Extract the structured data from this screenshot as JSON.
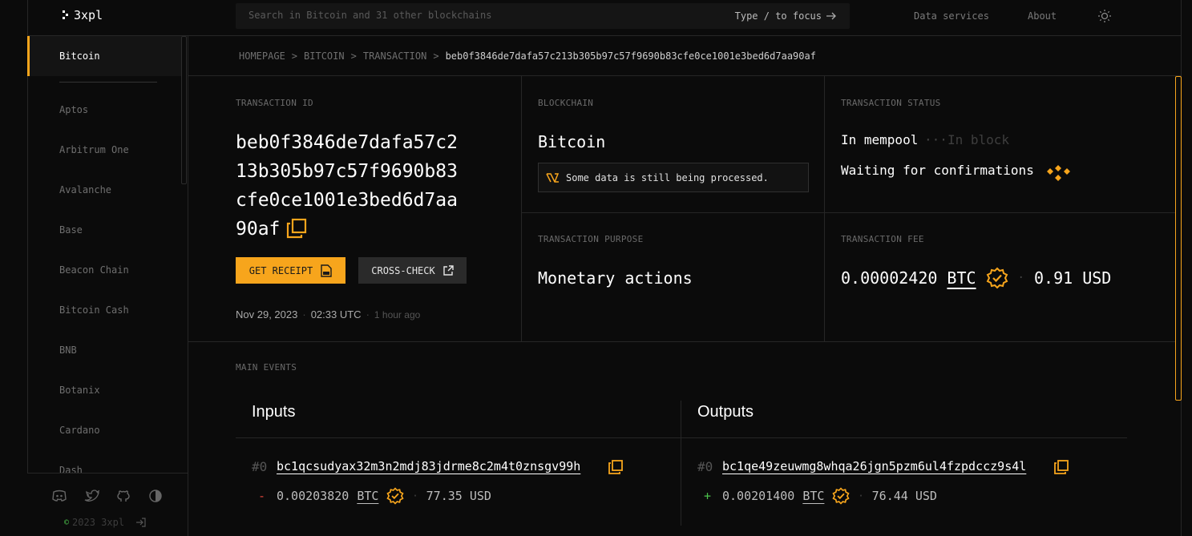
{
  "brand": {
    "name": "3xpl"
  },
  "search": {
    "placeholder": "Search in Bitcoin and 31 other blockchains",
    "hint": "Type / to focus"
  },
  "nav": {
    "data_services": "Data services",
    "about": "About",
    "theme_icon": "sun-icon"
  },
  "sidebar": {
    "active": "Bitcoin",
    "items": [
      "Aptos",
      "Arbitrum One",
      "Avalanche",
      "Base",
      "Beacon Chain",
      "Bitcoin Cash",
      "BNB",
      "Botanix",
      "Cardano",
      "Dash"
    ],
    "social_icons": [
      "discord-icon",
      "twitter-icon",
      "github-icon",
      "half-circle-icon"
    ],
    "copyright": "2023 3xpl"
  },
  "breadcrumb": [
    "HOMEPAGE",
    "BITCOIN",
    "TRANSACTION",
    "beb0f3846de7dafa57c213b305b97c57f9690b83cfe0ce1001e3bed6d7aa90af"
  ],
  "breadcrumb_sep": ">",
  "transaction": {
    "id_label": "TRANSACTION ID",
    "id": "beb0f3846de7dafa57c213b305b97c57f9690b83cfe0ce1001e3bed6d7aa90af",
    "receipt_button": "GET RECEIPT",
    "crosscheck_button": "CROSS-CHECK",
    "date": "Nov 29, 2023",
    "time": "02:33 UTC",
    "ago": "1 hour ago"
  },
  "blockchain": {
    "label": "BLOCKCHAIN",
    "name": "Bitcoin",
    "note": "Some data is still being processed."
  },
  "status": {
    "label": "TRANSACTION STATUS",
    "current": "In mempool",
    "dots": "···",
    "next": "In block",
    "waiting": "Waiting for confirmations"
  },
  "purpose": {
    "label": "TRANSACTION PURPOSE",
    "value": "Monetary actions"
  },
  "fee": {
    "label": "TRANSACTION FEE",
    "amount": "0.00002420",
    "unit": "BTC",
    "usd": "0.91 USD"
  },
  "events": {
    "label": "MAIN EVENTS",
    "inputs_title": "Inputs",
    "outputs_title": "Outputs",
    "inputs": [
      {
        "index": "#0",
        "address": "bc1qcsudyax32m3n2mdj83jdrme8c2m4t0znsgv99h",
        "sign": "-",
        "amount": "0.00203820",
        "unit": "BTC",
        "usd": "77.35 USD"
      }
    ],
    "outputs": [
      {
        "index": "#0",
        "address": "bc1qe49zeuwmg8whqa26jgn5pzm6ul4fzpdccz9s4l",
        "sign": "+",
        "amount": "0.00201400",
        "unit": "BTC",
        "usd": "76.44 USD"
      }
    ]
  },
  "colors": {
    "accent": "#f7a51c",
    "minus": "#e0443a",
    "plus": "#4cc24c"
  }
}
